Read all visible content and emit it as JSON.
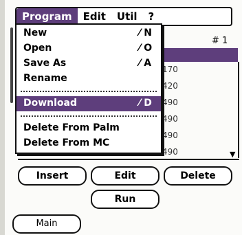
{
  "menubar": {
    "menus": [
      {
        "label": "Program"
      },
      {
        "label": "Edit"
      },
      {
        "label": "Util"
      },
      {
        "label": "?"
      }
    ]
  },
  "program_menu": {
    "items": [
      {
        "label": "New",
        "shortcut": "⁄ N"
      },
      {
        "label": "Open",
        "shortcut": "⁄ O"
      },
      {
        "label": "Save As",
        "shortcut": "⁄ A"
      },
      {
        "label": "Rename",
        "shortcut": ""
      },
      {
        "label": "Download",
        "shortcut": "⁄ D"
      },
      {
        "label": "Delete From Palm",
        "shortcut": ""
      },
      {
        "label": "Delete From MC",
        "shortcut": ""
      }
    ],
    "selected_item": "Download"
  },
  "list": {
    "header_number": "# 1",
    "values": [
      "170",
      "420",
      "490",
      "490",
      "490",
      "490"
    ]
  },
  "buttons": {
    "insert": "Insert",
    "edit": "Edit",
    "delete": "Delete",
    "run": "Run",
    "main": "Main"
  },
  "colors": {
    "highlight": "#5e3e7c"
  }
}
